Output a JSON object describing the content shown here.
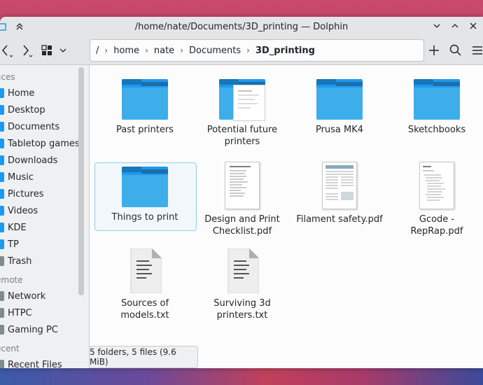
{
  "window": {
    "title": "/home/nate/Documents/3D_printing — Dolphin"
  },
  "breadcrumb": {
    "root": "/",
    "parts": [
      "home",
      "nate",
      "Documents",
      "3D_printing"
    ]
  },
  "sidebar": {
    "sections": [
      {
        "label": "aces"
      },
      {
        "label": "emote"
      },
      {
        "label": "ecent"
      }
    ],
    "places": [
      "Home",
      "Desktop",
      "Documents",
      "Tabletop games",
      "Downloads",
      "Music",
      "Pictures",
      "Videos",
      "KDE",
      "TP",
      "Trash"
    ],
    "remote": [
      "Network",
      "HTPC",
      "Gaming PC"
    ],
    "recent": [
      "Recent Files"
    ]
  },
  "items": [
    {
      "name": "Past printers",
      "type": "folder"
    },
    {
      "name": "Potential future printers",
      "type": "folder-with-doc"
    },
    {
      "name": "Prusa MK4",
      "type": "folder"
    },
    {
      "name": "Sketchbooks",
      "type": "folder"
    },
    {
      "name": "Things to print",
      "type": "folder",
      "selected": true
    },
    {
      "name": "Design and Print Checklist.pdf",
      "type": "pdf"
    },
    {
      "name": "Filament safety.pdf",
      "type": "pdf"
    },
    {
      "name": "Gcode - RepRap.pdf",
      "type": "pdf"
    },
    {
      "name": "Sources of models.txt",
      "type": "txt"
    },
    {
      "name": "Surviving 3d printers.txt",
      "type": "txt"
    }
  ],
  "status": {
    "summary": "5 folders, 5 files (9.6 MiB)"
  },
  "colors": {
    "folder": "#3daee9",
    "folder_dark": "#1b6ea8",
    "selection": "#93cee9"
  }
}
